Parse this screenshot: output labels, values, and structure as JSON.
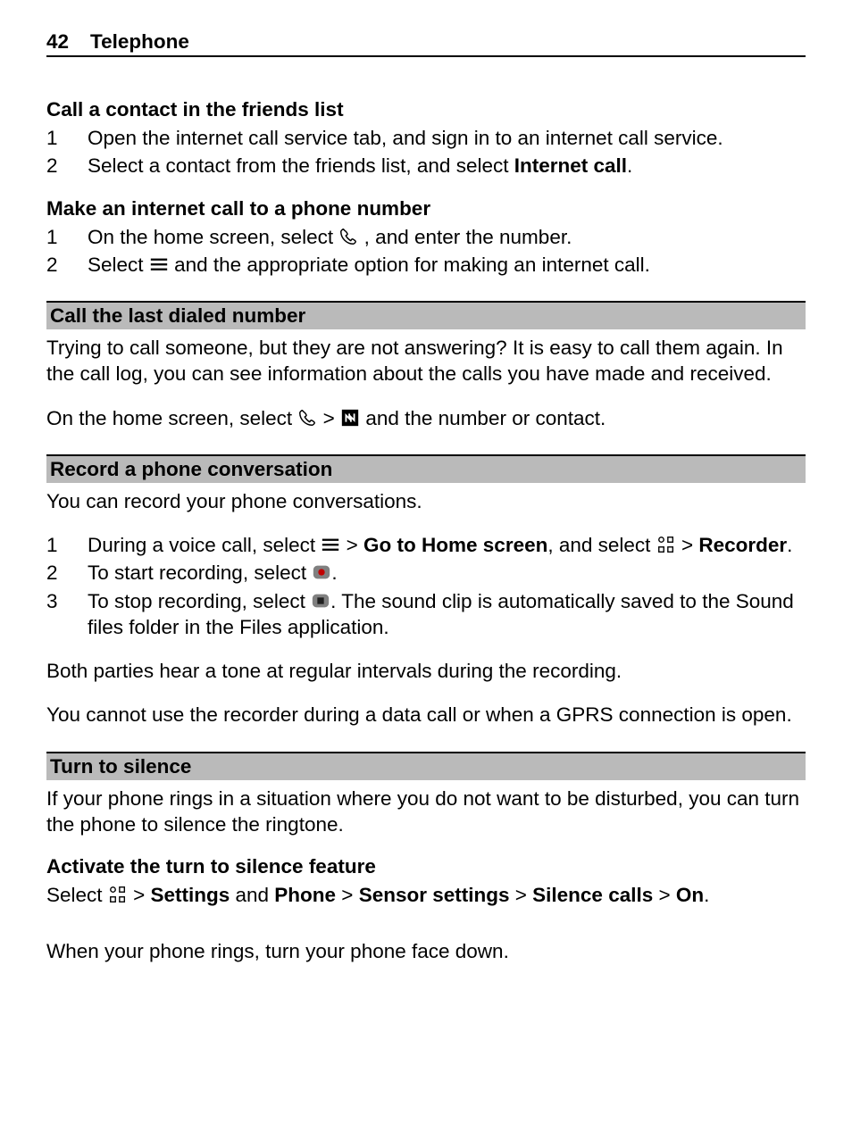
{
  "header": {
    "page_number": "42",
    "section_title": "Telephone"
  },
  "sections": {
    "friends": {
      "heading": "Call a contact in the friends list",
      "step1_num": "1",
      "step1_text": "Open the internet call service tab, and sign in to an internet call service.",
      "step2_num": "2",
      "step2_a": "Select a contact from the friends list, and select ",
      "step2_bold": "Internet call",
      "step2_b": "."
    },
    "internet_call": {
      "heading": "Make an internet call to a phone number",
      "step1_num": "1",
      "step1_a": "On the home screen, select ",
      "step1_b": " , and enter the number.",
      "step2_num": "2",
      "step2_a": "Select ",
      "step2_b": " and the appropriate option for making an internet call."
    },
    "last_dialed": {
      "banner": "Call the last dialed number",
      "para1": "Trying to call someone, but they are not answering? It is easy to call them again. In the call log, you can see information about the calls you have made and received.",
      "para2_a": "On the home screen, select ",
      "para2_arrow": "  > ",
      "para2_b": " and the number or contact."
    },
    "record": {
      "banner": "Record a phone conversation",
      "intro": "You can record your phone conversations.",
      "step1_num": "1",
      "step1_a": "During a voice call, select ",
      "step1_arrow1": "  > ",
      "step1_bold1": "Go to Home screen",
      "step1_mid": ", and select ",
      "step1_arrow2": "  > ",
      "step1_bold2": "Recorder",
      "step1_end": ".",
      "step2_num": "2",
      "step2_a": "To start recording, select ",
      "step2_b": ".",
      "step3_num": "3",
      "step3_a": "To stop recording, select ",
      "step3_b": ". The sound clip is automatically saved to the Sound files folder in the Files application.",
      "note1": "Both parties hear a tone at regular intervals during the recording.",
      "note2": "You cannot use the recorder during a data call or when a GPRS connection is open."
    },
    "silence": {
      "banner": "Turn to silence",
      "intro": "If your phone rings in a situation where you do not want to be disturbed, you can turn the phone to silence the ringtone.",
      "sub_heading": "Activate the turn to silence feature",
      "path_a": "Select ",
      "path_arrow1": "  > ",
      "path_bold1": "Settings",
      "path_and": " and ",
      "path_bold2": "Phone",
      "path_arrow2": "  > ",
      "path_bold3": "Sensor settings",
      "path_arrow3": "  > ",
      "path_bold4": "Silence calls",
      "path_arrow4": "  > ",
      "path_bold5": "On",
      "path_end": ".",
      "final": "When your phone rings, turn your phone face down."
    }
  }
}
